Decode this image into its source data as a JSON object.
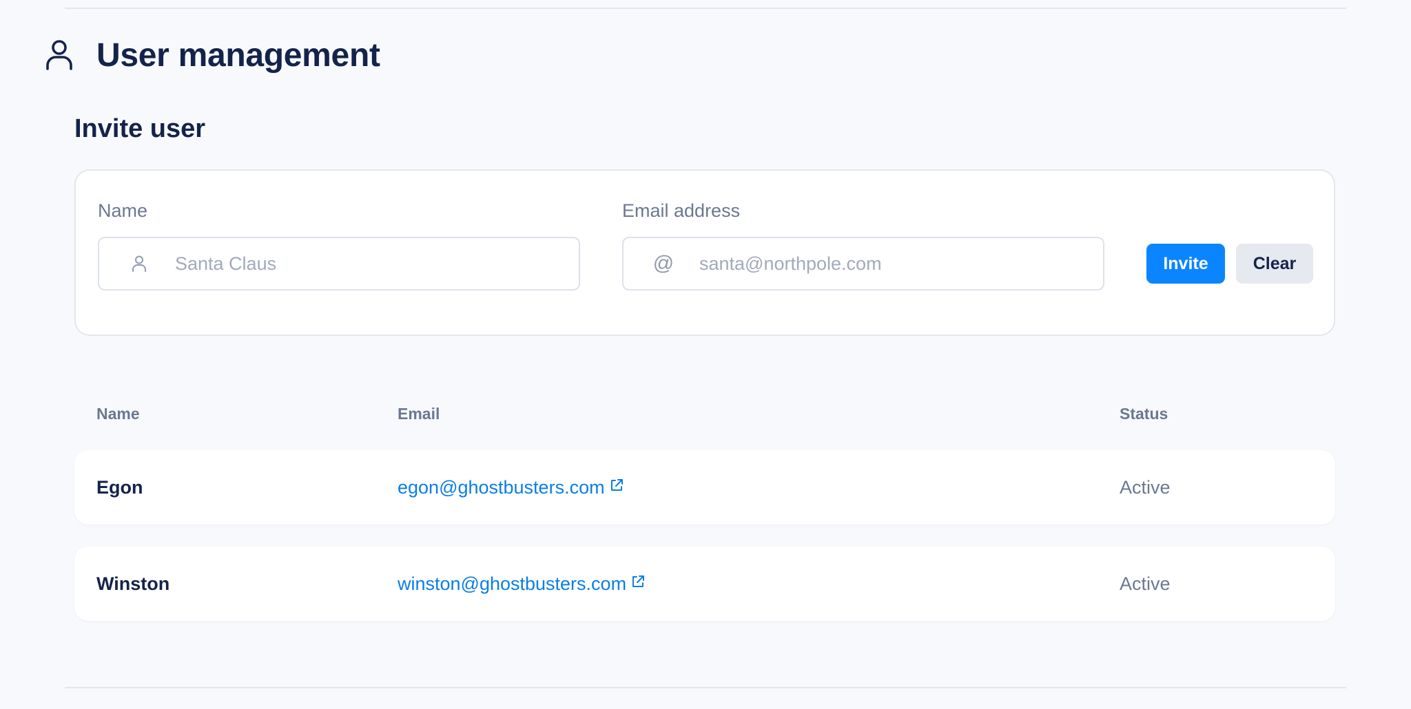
{
  "header": {
    "title": "User management",
    "icon": "user-icon"
  },
  "invite": {
    "section_title": "Invite user",
    "name_label": "Name",
    "name_placeholder": "Santa Claus",
    "name_icon": "user-icon",
    "email_label": "Email address",
    "email_placeholder": "santa@northpole.com",
    "email_icon": "at-sign-icon",
    "invite_button": "Invite",
    "clear_button": "Clear"
  },
  "table": {
    "columns": [
      "Name",
      "Email",
      "Status"
    ],
    "rows": [
      {
        "name": "Egon",
        "email": "egon@ghostbusters.com",
        "status": "Active"
      },
      {
        "name": "Winston",
        "email": "winston@ghostbusters.com",
        "status": "Active"
      }
    ]
  },
  "colors": {
    "background": "#f8f9fc",
    "primary": "#0a85ff",
    "link": "#0a7ee6",
    "heading": "#14234b",
    "muted": "#6b7891"
  }
}
